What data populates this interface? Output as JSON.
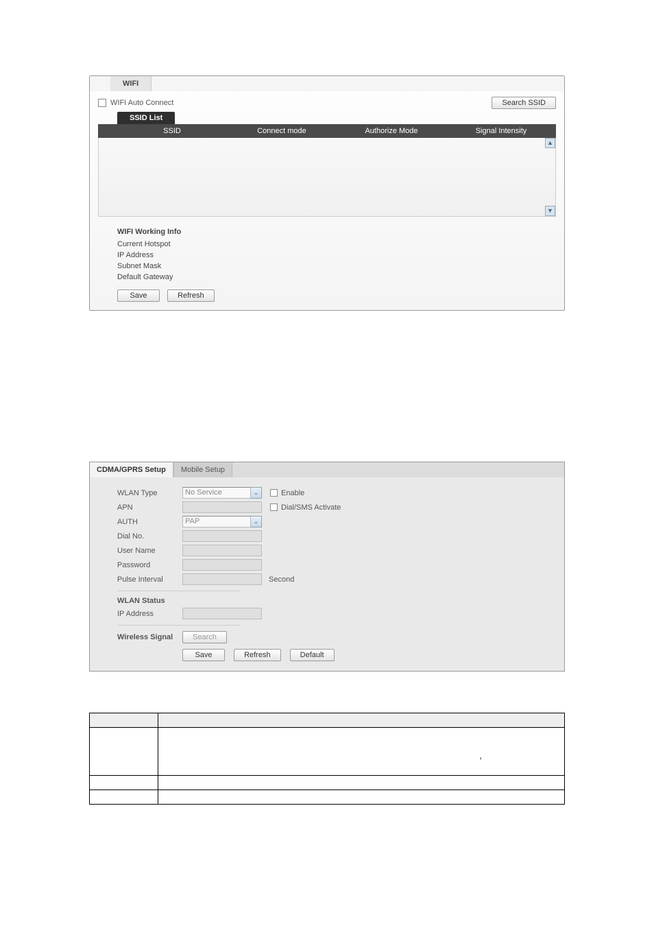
{
  "wifi": {
    "title": "WIFI",
    "auto_connect_label": "WIFI Auto Connect",
    "search_btn": "Search SSID",
    "ssid_tab": "SSID List",
    "cols": {
      "ssid": "SSID",
      "connect": "Connect mode",
      "auth": "Authorize Mode",
      "signal": "Signal Intensity"
    },
    "info": {
      "heading": "WIFI Working Info",
      "hotspot": "Current Hotspot",
      "ip": "IP Address",
      "mask": "Subnet Mask",
      "gw": "Default Gateway"
    },
    "save": "Save",
    "refresh": "Refresh"
  },
  "g3": {
    "tab_active": "CDMA/GPRS Setup",
    "tab_inactive": "Mobile Setup",
    "labels": {
      "wlan_type": "WLAN Type",
      "apn": "APN",
      "auth": "AUTH",
      "dial": "Dial No.",
      "user": "User Name",
      "pwd": "Password",
      "pulse": "Pulse Interval",
      "wlan_status": "WLAN Status",
      "ip": "IP Address",
      "wireless": "Wireless Signal"
    },
    "values": {
      "wlan_type": "No Service",
      "auth": "PAP"
    },
    "enable": "Enable",
    "dial_sms": "Dial/SMS Activate",
    "second": "Second",
    "search": "Search",
    "save": "Save",
    "refresh": "Refresh",
    "default": "Default"
  },
  "ptable": {
    "h1": "",
    "h2": "",
    "r1c1": "",
    "r1c2_comma": ",",
    "r2c1": "",
    "r2c2": "",
    "r3c1": "",
    "r3c2": ""
  }
}
